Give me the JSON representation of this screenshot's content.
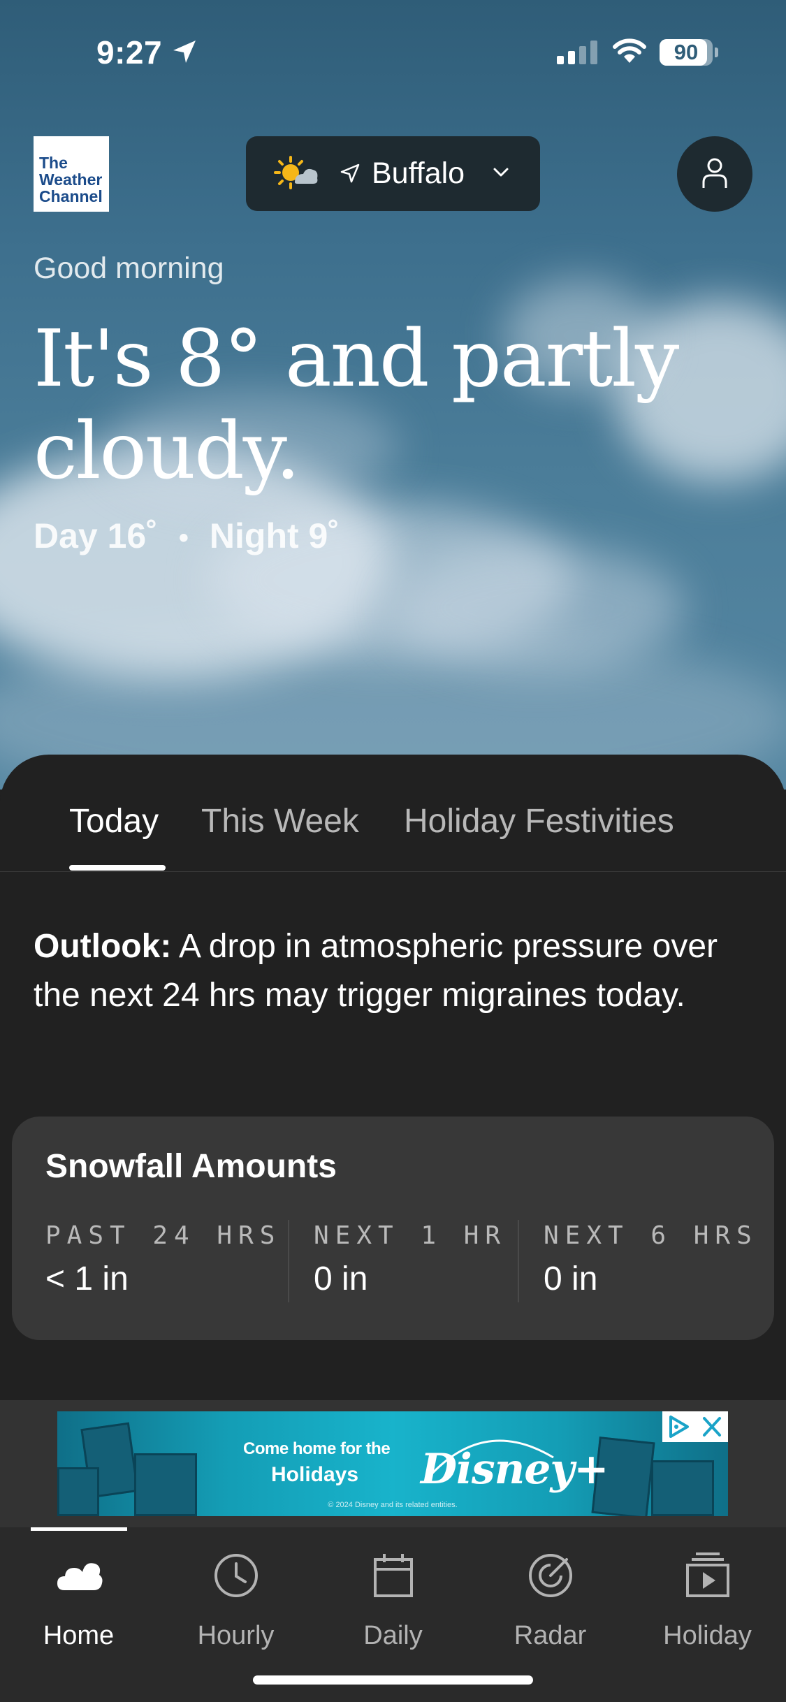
{
  "status_bar": {
    "time": "9:27",
    "battery": "90",
    "battery_level": 0.9
  },
  "header": {
    "logo_lines": [
      "The",
      "Weather",
      "Channel"
    ],
    "city": "Buffalo"
  },
  "hero": {
    "greeting": "Good morning",
    "headline": "It's 8° and partly cloudy.",
    "day": "Day 16˚",
    "night": "Night 9˚"
  },
  "tabs": [
    {
      "label": "Today",
      "active": true
    },
    {
      "label": "This Week",
      "active": false
    },
    {
      "label": "Holiday Festivities",
      "active": false
    }
  ],
  "outlook": {
    "label": "Outlook:",
    "text": "A drop in atmospheric pressure over the next 24 hrs may trigger migraines today."
  },
  "snowfall": {
    "title": "Snowfall Amounts",
    "columns": [
      {
        "label": "PAST 24 HRS",
        "value": "< 1 in"
      },
      {
        "label": "NEXT 1 HR",
        "value": "0 in"
      },
      {
        "label": "NEXT 6 HRS",
        "value": "0 in"
      }
    ]
  },
  "ad": {
    "line1": "Come home for the",
    "line2": "Holidays",
    "brand": "Disney+",
    "fine_print": "© 2024 Disney and its related entities."
  },
  "nav": [
    {
      "label": "Home",
      "icon": "cloud-icon",
      "active": true
    },
    {
      "label": "Hourly",
      "icon": "clock-icon",
      "active": false
    },
    {
      "label": "Daily",
      "icon": "calendar-icon",
      "active": false
    },
    {
      "label": "Radar",
      "icon": "radar-icon",
      "active": false
    },
    {
      "label": "Holiday",
      "icon": "video-icon",
      "active": false
    }
  ],
  "colors": {
    "sky": "#3d6f8d",
    "card": "#212121",
    "snow_card": "#383838",
    "ad_teal": "#18b3cb"
  }
}
